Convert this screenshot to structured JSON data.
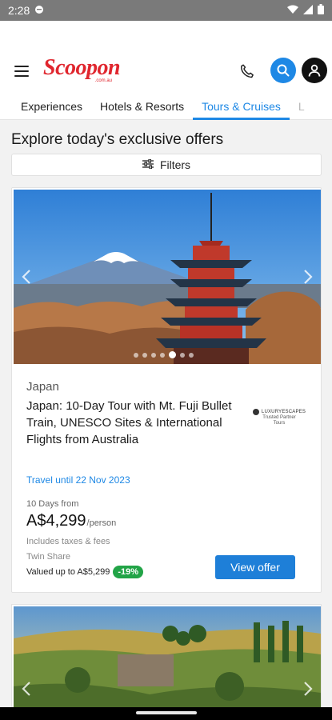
{
  "status_bar": {
    "time": "2:28"
  },
  "header": {
    "logo_text": "Scoopon",
    "logo_sub": ".com.au",
    "tabs": [
      {
        "label": "Experiences"
      },
      {
        "label": "Hotels & Resorts"
      },
      {
        "label": "Tours & Cruises",
        "active": true
      },
      {
        "label": "L"
      }
    ]
  },
  "main": {
    "title": "Explore today's exclusive offers",
    "filters_label": "Filters"
  },
  "deal": {
    "location": "Japan",
    "title": "Japan: 10-Day Tour with Mt. Fuji Bullet Train, UNESCO Sites & International Flights from Australia",
    "partner": {
      "brand": "LUXURYESCAPES",
      "line1": "Trusted Partner",
      "line2": "Tours"
    },
    "travel_until": "Travel until 22 Nov 2023",
    "duration": "10 Days from",
    "price": "A$4,299",
    "per": "/person",
    "taxes": "Includes taxes & fees",
    "share": "Twin Share",
    "valued": "Valued up to A$5,299",
    "discount": "-19%",
    "cta": "View offer",
    "carousel": {
      "count": 7,
      "active_index": 4
    }
  },
  "colors": {
    "brand": "#e0262e",
    "accent": "#1e88e5",
    "discount": "#22a447"
  }
}
